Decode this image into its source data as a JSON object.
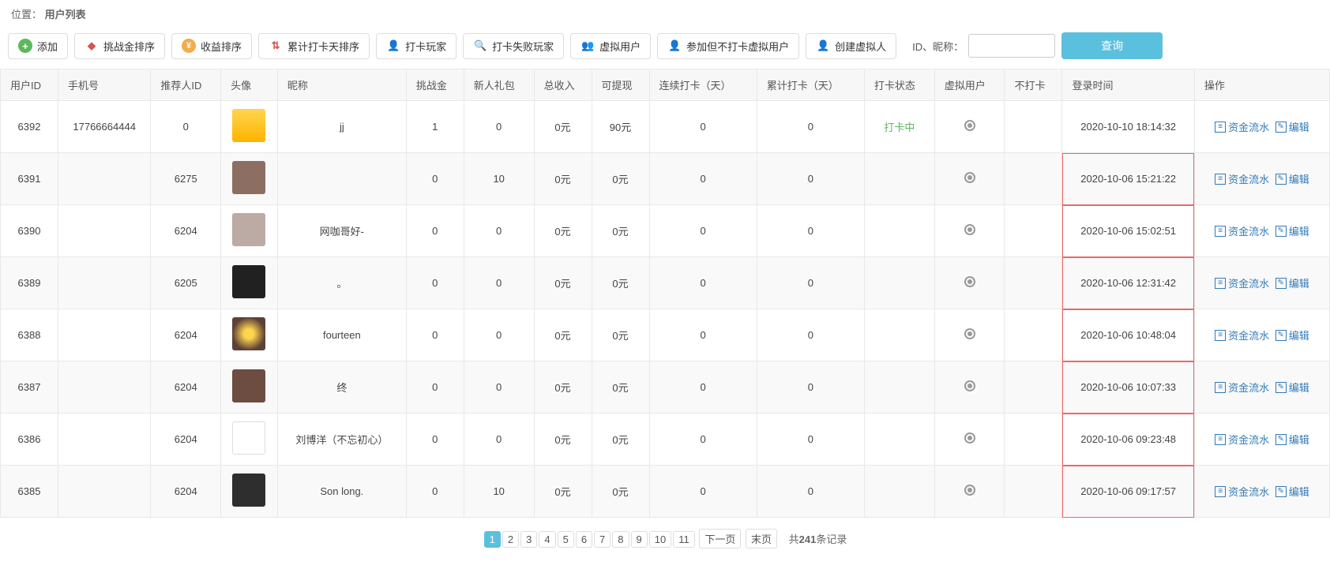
{
  "breadcrumb": {
    "label": "位置：",
    "page": "用户列表"
  },
  "toolbar": {
    "add": "添加",
    "challenge_sort": "挑战金排序",
    "revenue_sort": "收益排序",
    "cumulative_sort": "累计打卡天排序",
    "punch_players": "打卡玩家",
    "punch_fail_players": "打卡失败玩家",
    "virtual_users": "虚拟用户",
    "join_no_punch_virtual": "参加但不打卡虚拟用户",
    "create_virtual": "创建虚拟人"
  },
  "search": {
    "label": "ID、昵称：",
    "value": "",
    "button": "查询"
  },
  "columns": [
    "用户ID",
    "手机号",
    "推荐人ID",
    "头像",
    "昵称",
    "挑战金",
    "新人礼包",
    "总收入",
    "可提现",
    "连续打卡（天）",
    "累计打卡（天）",
    "打卡状态",
    "虚拟用户",
    "不打卡",
    "登录时间",
    "操作"
  ],
  "actions": {
    "fund_flow": "资金流水",
    "edit": "编辑"
  },
  "rows": [
    {
      "id": "6392",
      "phone": "17766664444",
      "referrer": "0",
      "avatar": "av1",
      "nick": "jj",
      "challenge": "1",
      "gift": "0",
      "income": "0元",
      "withdraw": "90元",
      "cont": "0",
      "cum": "0",
      "status": "打卡中",
      "status_ok": true,
      "login": "2020-10-10 18:14:32"
    },
    {
      "id": "6391",
      "phone": "",
      "referrer": "6275",
      "avatar": "av2",
      "nick": "",
      "challenge": "0",
      "gift": "10",
      "income": "0元",
      "withdraw": "0元",
      "cont": "0",
      "cum": "0",
      "status": "",
      "status_ok": false,
      "login": "2020-10-06 15:21:22"
    },
    {
      "id": "6390",
      "phone": "",
      "referrer": "6204",
      "avatar": "av3",
      "nick": "网咖哥好-",
      "challenge": "0",
      "gift": "0",
      "income": "0元",
      "withdraw": "0元",
      "cont": "0",
      "cum": "0",
      "status": "",
      "status_ok": false,
      "login": "2020-10-06 15:02:51"
    },
    {
      "id": "6389",
      "phone": "",
      "referrer": "6205",
      "avatar": "av4",
      "nick": "。",
      "challenge": "0",
      "gift": "0",
      "income": "0元",
      "withdraw": "0元",
      "cont": "0",
      "cum": "0",
      "status": "",
      "status_ok": false,
      "login": "2020-10-06 12:31:42"
    },
    {
      "id": "6388",
      "phone": "",
      "referrer": "6204",
      "avatar": "av5",
      "nick": "fourteen",
      "challenge": "0",
      "gift": "0",
      "income": "0元",
      "withdraw": "0元",
      "cont": "0",
      "cum": "0",
      "status": "",
      "status_ok": false,
      "login": "2020-10-06 10:48:04"
    },
    {
      "id": "6387",
      "phone": "",
      "referrer": "6204",
      "avatar": "av6",
      "nick": "终",
      "challenge": "0",
      "gift": "0",
      "income": "0元",
      "withdraw": "0元",
      "cont": "0",
      "cum": "0",
      "status": "",
      "status_ok": false,
      "login": "2020-10-06 10:07:33"
    },
    {
      "id": "6386",
      "phone": "",
      "referrer": "6204",
      "avatar": "av7",
      "nick": "刘博洋（不忘初心）",
      "challenge": "0",
      "gift": "0",
      "income": "0元",
      "withdraw": "0元",
      "cont": "0",
      "cum": "0",
      "status": "",
      "status_ok": false,
      "login": "2020-10-06 09:23:48"
    },
    {
      "id": "6385",
      "phone": "",
      "referrer": "6204",
      "avatar": "av8",
      "nick": "Son long.",
      "challenge": "0",
      "gift": "10",
      "income": "0元",
      "withdraw": "0元",
      "cont": "0",
      "cum": "0",
      "status": "",
      "status_ok": false,
      "login": "2020-10-06 09:17:57"
    }
  ],
  "pagination": {
    "pages": [
      "1",
      "2",
      "3",
      "4",
      "5",
      "6",
      "7",
      "8",
      "9",
      "10",
      "11"
    ],
    "active": "1",
    "next": "下一页",
    "last": "末页",
    "info_prefix": "共",
    "total": "241",
    "info_suffix": "条记录"
  }
}
